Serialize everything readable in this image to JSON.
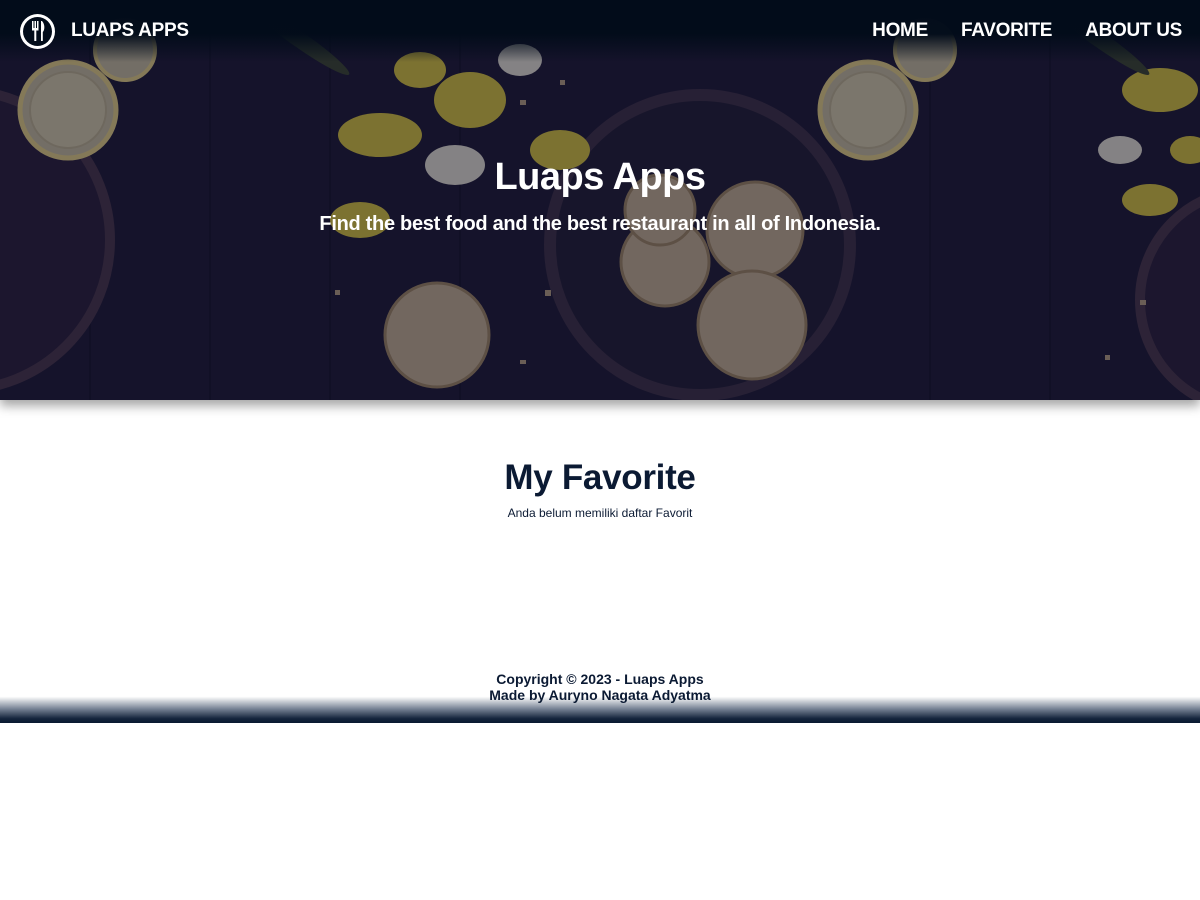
{
  "header": {
    "brand": "LUAPS APPS",
    "logo_icon": "fork-knife-icon",
    "nav": [
      {
        "label": "HOME"
      },
      {
        "label": "FAVORITE"
      },
      {
        "label": "ABOUT US"
      }
    ]
  },
  "hero": {
    "title": "Luaps Apps",
    "tagline": "Find the best food and the best restaurant in all of Indonesia."
  },
  "main": {
    "title": "My Favorite",
    "empty_message": "Anda belum memiliki daftar Favorit"
  },
  "footer": {
    "copyright": "Copyright © 2023 - Luaps Apps",
    "credit": "Made by Auryno Nagata Adyatma"
  },
  "colors": {
    "navbar": "#020c1a",
    "text_dark": "#0b1a33",
    "hero_overlay": "#0a0828"
  }
}
